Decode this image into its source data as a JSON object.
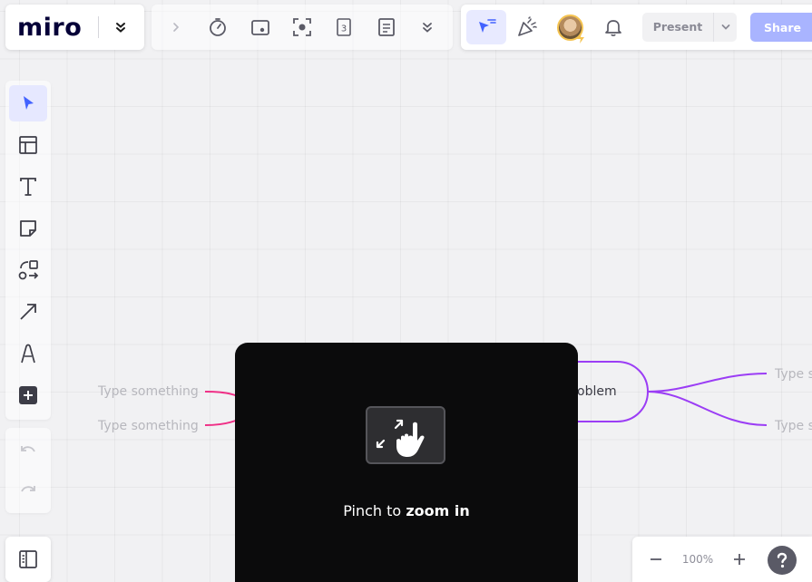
{
  "app": {
    "logo": "miro"
  },
  "top_toolbar": {
    "items": [
      {
        "name": "expand",
        "icon": "chevron-right-icon"
      },
      {
        "name": "timer",
        "icon": "timer-icon"
      },
      {
        "name": "voting",
        "icon": "card-icon"
      },
      {
        "name": "focus",
        "icon": "focus-icon"
      },
      {
        "name": "card-3",
        "icon": "counter-card-icon"
      },
      {
        "name": "notes",
        "icon": "notes-icon"
      },
      {
        "name": "more",
        "icon": "double-chevron-down-icon"
      }
    ]
  },
  "header_right": {
    "present_label": "Present",
    "share_label": "Share"
  },
  "left_toolbar": {
    "items": [
      {
        "name": "select",
        "icon": "cursor-icon",
        "active": true
      },
      {
        "name": "templates",
        "icon": "layout-icon"
      },
      {
        "name": "text",
        "icon": "text-icon"
      },
      {
        "name": "sticky-note",
        "icon": "sticky-note-icon"
      },
      {
        "name": "shapes",
        "icon": "shapes-icon"
      },
      {
        "name": "connection-line",
        "icon": "arrow-line-icon"
      },
      {
        "name": "pen",
        "icon": "pen-icon"
      },
      {
        "name": "add",
        "icon": "plus-icon"
      }
    ]
  },
  "zoom": {
    "level": "100%"
  },
  "canvas": {
    "mindmap": {
      "root_label": "oblem",
      "left_nodes": [
        "Type something",
        "Type something"
      ],
      "right_nodes": [
        "Type s",
        "Type s"
      ]
    }
  },
  "hint": {
    "prefix": "Pinch to ",
    "emphasis": "zoom in"
  },
  "colors": {
    "accent": "#4262ff",
    "share_button": "#a9b4ff",
    "mindmap_left": "#ef2f86",
    "mindmap_right": "#9b3df5",
    "overlay": "#0b0b0c"
  }
}
